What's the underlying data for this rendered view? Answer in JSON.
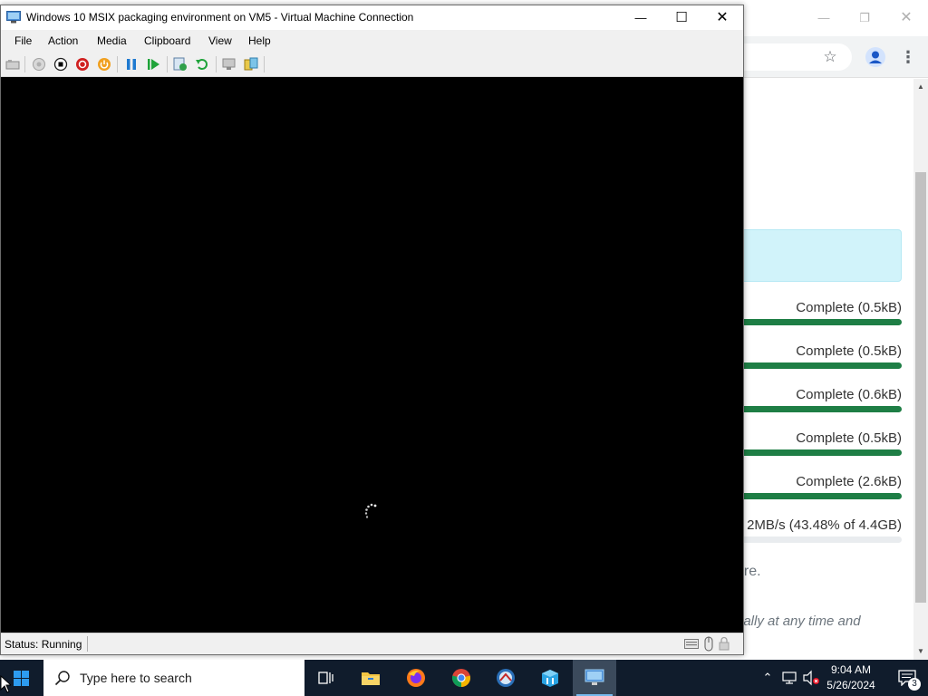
{
  "vm_window": {
    "title": "Windows 10 MSIX packaging environment on VM5 - Virtual Machine Connection",
    "menu": [
      "File",
      "Action",
      "Media",
      "Clipboard",
      "View",
      "Help"
    ],
    "toolbar_icons": [
      "ctrl-alt-del-icon",
      "start-icon",
      "turn-off-icon",
      "shut-down-icon",
      "power-icon",
      "pause-icon",
      "resume-icon",
      "checkpoint-icon",
      "revert-icon",
      "enhanced-session-icon",
      "share-icon"
    ],
    "status": "Status: Running"
  },
  "browser": {
    "downloads": [
      {
        "label": "Complete (0.5kB)",
        "progress": 1.0
      },
      {
        "label": "Complete (0.5kB)",
        "progress": 1.0
      },
      {
        "label": "Complete (0.6kB)",
        "progress": 1.0
      },
      {
        "label": "Complete (0.5kB)",
        "progress": 1.0
      },
      {
        "label": "Complete (2.6kB)",
        "progress": 1.0
      },
      {
        "label": "2MB/s (43.48% of 4.4GB)",
        "progress": 0.0
      }
    ],
    "text_fragment_1": "are.",
    "text_fragment_2": "ually at any time and"
  },
  "taskbar": {
    "search_placeholder": "Type here to search",
    "apps": [
      "task-view-icon",
      "file-explorer-icon",
      "firefox-icon",
      "chrome-icon",
      "app-icon",
      "package-icon",
      "hyper-v-icon"
    ],
    "clock_time": "9:04 AM",
    "clock_date": "5/26/2024",
    "notification_count": "3"
  },
  "colors": {
    "progress_green": "#1e7e45",
    "alert_bg": "#d1f3fa",
    "taskbar_bg": "#101c2c"
  }
}
